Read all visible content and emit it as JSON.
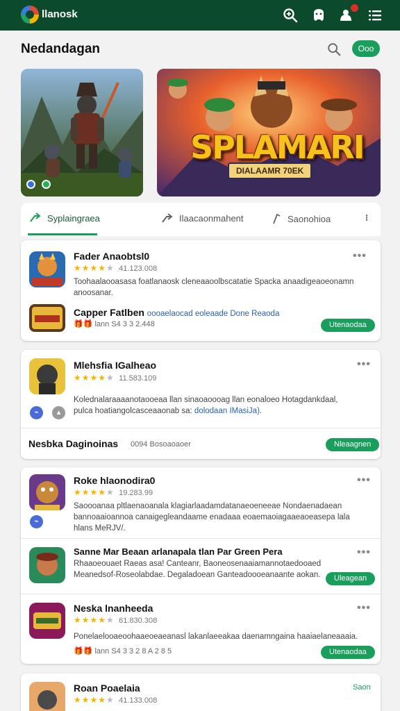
{
  "app": {
    "name": "llanosk"
  },
  "header": {
    "title": "Nedandagan",
    "go_label": "Ooo"
  },
  "hero": {
    "splash_title": "SPLAMARI",
    "splash_subtitle": "DIALAAMR 70EK"
  },
  "tabs": [
    {
      "label": "Syplaingraea"
    },
    {
      "label": "Ilaacaonmahent"
    },
    {
      "label": "Saonohioa"
    }
  ],
  "cards": {
    "c1": {
      "app1": {
        "name": "Fader Anaobtsl0",
        "rating": "★★★★",
        "count": "41.123.008",
        "desc": "Toohaalaooasasa foatlanaosk cleneaaoolbscatatie Spacka anaadigeaoeonamn anoosanar."
      },
      "app2": {
        "name": "Capper Fatlben",
        "name_extra": "oooaelaocad eoleaade Done Reaoda",
        "meta": "lann S4 3 3 2.448",
        "action": "Utenaodaa"
      }
    },
    "c2": {
      "app": {
        "name": "Mlehsfia IGalheao",
        "rating": "★★★★",
        "count": "11.583.109",
        "desc1": "Kolednalaraaaanotaooeaa llan sinaoaoooag llan eonaloeo Hotagdankdaal,",
        "desc2": "pulca hoatiangolcasceaaonab sa:",
        "desc2_link": "dolodaan IMasiJa)."
      },
      "footer": {
        "label": "Nesbka Daginoinas",
        "meta": "0094 Bosoaoaoer",
        "action": "Nleaagnen"
      }
    },
    "c3": {
      "app1": {
        "name": "Roke hlaonodira0",
        "rating": "★★★★",
        "count": "19.283.99",
        "desc": "Saoooanaa pltlaenaoanala klagiarlaadamdatanaeoeneeae Nondaenadaean bannoaaioannoa canaigegleandaame enadaaa eoaemaoiagaaeaoeasepa lala hlans MeRJV/."
      },
      "app2": {
        "name": "Sanne Mar Beaan arlanapala tlan Par Green Pera",
        "desc": "Rhaaoeouaet Raeas asa! Canteanr, Baoneosenaaiamannotaedooaed Meanedsof-Roseolabdae. Degaladoean Ganteadoooeanaante aokan.",
        "action": "Uleagean"
      },
      "app3": {
        "name": "Neska lnanheeda",
        "rating": "★★★★",
        "count": "61.830.308",
        "desc": "Ponelaelooaeoohaaeoeaeanasl lakanlaeeakaa daenamngaina haaiaelaneaaaia.",
        "meta": "lann S4 3 3 2 8 A 2 8 5",
        "action": "Utenaodaa"
      }
    },
    "c4": {
      "app": {
        "name": "Roan Poaelaia",
        "rating": "★★★★",
        "count": "41.133.008",
        "action": "Saon"
      }
    }
  },
  "colors": {
    "topbar": "#0c4a2c",
    "accent": "#1a9e5c",
    "star": "#f4b400"
  }
}
